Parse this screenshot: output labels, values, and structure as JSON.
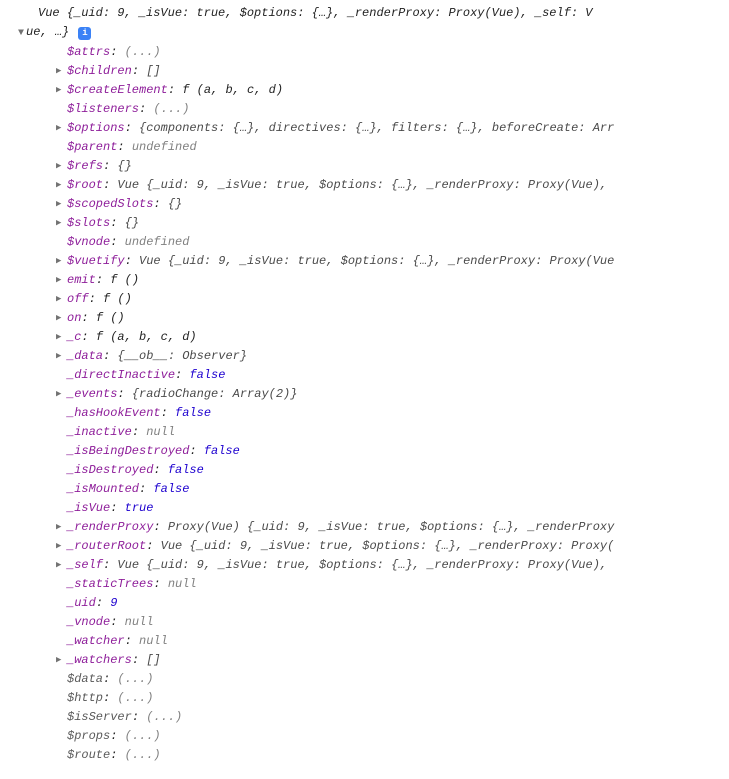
{
  "header": {
    "prefix": "Vue ",
    "summary": "{_uid: 9, _isVue: true, $options: {…}, _renderProxy: Proxy(Vue), _self: V",
    "wrap": "ue, …}"
  },
  "entries": [
    {
      "arrow": false,
      "keyColor": "purple",
      "key": "$attrs",
      "valColor": "gray",
      "val": "(...)"
    },
    {
      "arrow": true,
      "keyColor": "purple",
      "key": "$children",
      "valColor": "str",
      "val": "[]"
    },
    {
      "arrow": true,
      "keyColor": "purple",
      "key": "$createElement",
      "isFn": true,
      "fnArgs": "(a, b, c, d)"
    },
    {
      "arrow": false,
      "keyColor": "purple",
      "key": "$listeners",
      "valColor": "gray",
      "val": "(...)"
    },
    {
      "arrow": true,
      "keyColor": "purple",
      "key": "$options",
      "valColor": "str",
      "val": "{components: {…}, directives: {…}, filters: {…}, beforeCreate: Arr"
    },
    {
      "arrow": false,
      "keyColor": "purple",
      "key": "$parent",
      "valColor": "gray",
      "val": "undefined"
    },
    {
      "arrow": true,
      "keyColor": "purple",
      "key": "$refs",
      "valColor": "str",
      "val": "{}"
    },
    {
      "arrow": true,
      "keyColor": "purple",
      "key": "$root",
      "valColor": "str",
      "val": "Vue {_uid: 9, _isVue: true, $options: {…}, _renderProxy: Proxy(Vue),"
    },
    {
      "arrow": true,
      "keyColor": "purple",
      "key": "$scopedSlots",
      "valColor": "str",
      "val": "{}"
    },
    {
      "arrow": true,
      "keyColor": "purple",
      "key": "$slots",
      "valColor": "str",
      "val": "{}"
    },
    {
      "arrow": false,
      "keyColor": "purple",
      "key": "$vnode",
      "valColor": "gray",
      "val": "undefined"
    },
    {
      "arrow": true,
      "keyColor": "purple",
      "key": "$vuetify",
      "valColor": "str",
      "val": "Vue {_uid: 9, _isVue: true, $options: {…}, _renderProxy: Proxy(Vue"
    },
    {
      "arrow": true,
      "keyColor": "purple",
      "key": "emit",
      "isFn": true,
      "fnArgs": "()"
    },
    {
      "arrow": true,
      "keyColor": "purple",
      "key": "off",
      "isFn": true,
      "fnArgs": "()"
    },
    {
      "arrow": true,
      "keyColor": "purple",
      "key": "on",
      "isFn": true,
      "fnArgs": "()"
    },
    {
      "arrow": true,
      "keyColor": "purple",
      "key": "_c",
      "isFn": true,
      "fnArgs": "(a, b, c, d)"
    },
    {
      "arrow": true,
      "keyColor": "purple",
      "key": "_data",
      "valColor": "str",
      "val": "{__ob__: Observer}"
    },
    {
      "arrow": false,
      "keyColor": "purple",
      "key": "_directInactive",
      "valColor": "blue",
      "val": "false"
    },
    {
      "arrow": true,
      "keyColor": "purple",
      "key": "_events",
      "valColor": "str",
      "val": "{radioChange: Array(2)}"
    },
    {
      "arrow": false,
      "keyColor": "purple",
      "key": "_hasHookEvent",
      "valColor": "blue",
      "val": "false"
    },
    {
      "arrow": false,
      "keyColor": "purple",
      "key": "_inactive",
      "valColor": "gray",
      "val": "null"
    },
    {
      "arrow": false,
      "keyColor": "purple",
      "key": "_isBeingDestroyed",
      "valColor": "blue",
      "val": "false"
    },
    {
      "arrow": false,
      "keyColor": "purple",
      "key": "_isDestroyed",
      "valColor": "blue",
      "val": "false"
    },
    {
      "arrow": false,
      "keyColor": "purple",
      "key": "_isMounted",
      "valColor": "blue",
      "val": "false"
    },
    {
      "arrow": false,
      "keyColor": "purple",
      "key": "_isVue",
      "valColor": "blue",
      "val": "true"
    },
    {
      "arrow": true,
      "keyColor": "purple",
      "key": "_renderProxy",
      "valColor": "str",
      "val": "Proxy(Vue) {_uid: 9, _isVue: true, $options: {…}, _renderProxy"
    },
    {
      "arrow": true,
      "keyColor": "purple",
      "key": "_routerRoot",
      "valColor": "str",
      "val": "Vue {_uid: 9, _isVue: true, $options: {…}, _renderProxy: Proxy("
    },
    {
      "arrow": true,
      "keyColor": "purple",
      "key": "_self",
      "valColor": "str",
      "val": "Vue {_uid: 9, _isVue: true, $options: {…}, _renderProxy: Proxy(Vue),"
    },
    {
      "arrow": false,
      "keyColor": "purple",
      "key": "_staticTrees",
      "valColor": "gray",
      "val": "null"
    },
    {
      "arrow": false,
      "keyColor": "purple",
      "key": "_uid",
      "valColor": "blue",
      "val": "9"
    },
    {
      "arrow": false,
      "keyColor": "purple",
      "key": "_vnode",
      "valColor": "gray",
      "val": "null"
    },
    {
      "arrow": false,
      "keyColor": "purple",
      "key": "_watcher",
      "valColor": "gray",
      "val": "null"
    },
    {
      "arrow": true,
      "keyColor": "purple",
      "key": "_watchers",
      "valColor": "str",
      "val": "[]"
    },
    {
      "arrow": false,
      "keyColor": "gray",
      "key": "$data",
      "valColor": "gray",
      "val": "(...)"
    },
    {
      "arrow": false,
      "keyColor": "gray",
      "key": "$http",
      "valColor": "gray",
      "val": "(...)"
    },
    {
      "arrow": false,
      "keyColor": "gray",
      "key": "$isServer",
      "valColor": "gray",
      "val": "(...)"
    },
    {
      "arrow": false,
      "keyColor": "gray",
      "key": "$props",
      "valColor": "gray",
      "val": "(...)"
    },
    {
      "arrow": false,
      "keyColor": "gray",
      "key": "$route",
      "valColor": "gray",
      "val": "(...)"
    }
  ]
}
